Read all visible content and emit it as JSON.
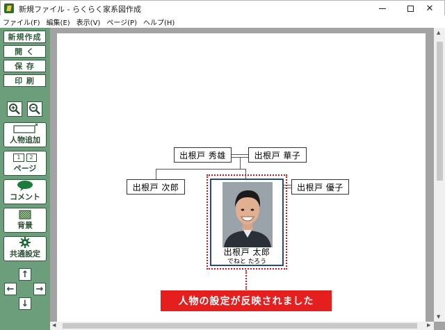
{
  "window": {
    "title": "新規ファイル - らくらく家系図作成",
    "minimize_symbol": "",
    "maximize_symbol": "",
    "close_symbol": "✕"
  },
  "menu": [
    {
      "label": "ファイル(F)"
    },
    {
      "label": "編集(E)"
    },
    {
      "label": "表示(V)"
    },
    {
      "label": "ページ(P)"
    },
    {
      "label": "ヘルプ(H)"
    }
  ],
  "toolbar": {
    "new_label": "新規作成",
    "open_label": "開 く",
    "save_label": "保 存",
    "print_label": "印 刷",
    "zoom_in_icon": "zoom-in-icon",
    "zoom_out_icon": "zoom-out-icon",
    "add_person_label": "人物追加",
    "page_label": "ページ",
    "page_icon_numbers": [
      "1",
      "2"
    ],
    "comment_label": "コメント",
    "background_label": "背景",
    "settings_label": "共通設定",
    "arrows": {
      "up": "↑",
      "left": "←",
      "right": "→",
      "down": "↓"
    }
  },
  "tree": {
    "father": "出根戸  秀雄",
    "mother": "出根戸  華子",
    "sibling": "出根戸  次郎",
    "spouse": "出根戸  優子",
    "selected_name": "出根戸  太郎",
    "selected_kana": "でねと  たろう"
  },
  "notification": "人物の設定が反映されました",
  "colors": {
    "toolbar_bg": "#6d9e7b",
    "toolbar_text": "#2a4f33",
    "selection": "#cc1111",
    "card_border": "#234a7a",
    "toast_bg": "#e51e1e"
  }
}
